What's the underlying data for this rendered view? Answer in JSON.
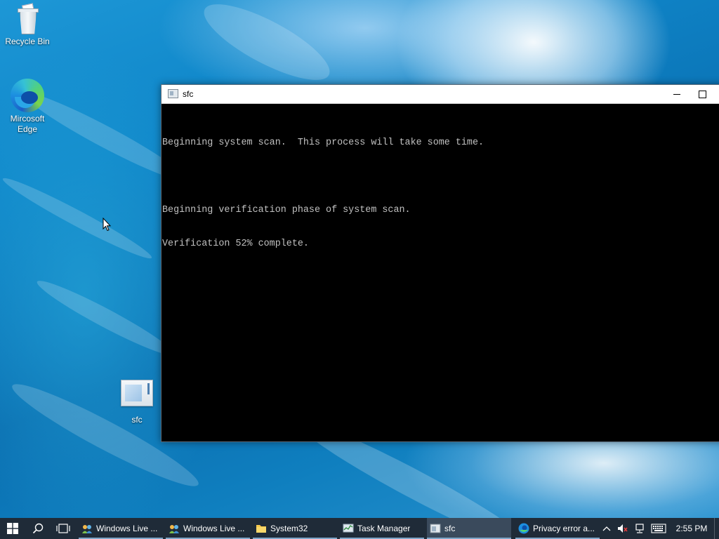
{
  "desktop": {
    "icons": [
      {
        "label": "Recycle Bin",
        "icon": "recycle-bin-icon"
      },
      {
        "label": "Mircosoft\nEdge",
        "icon": "edge-icon"
      },
      {
        "label": "sfc",
        "icon": "sfc-app-icon"
      }
    ]
  },
  "window": {
    "title": "sfc",
    "icon": "console-window-icon",
    "controls": {
      "minimize": "minimize-icon",
      "maximize": "maximize-icon"
    },
    "console_lines": [
      "Beginning system scan.  This process will take some time.",
      "",
      "Beginning verification phase of system scan.",
      "Verification 52% complete."
    ]
  },
  "taskbar": {
    "start": "windows-start-icon",
    "search": "search-icon",
    "taskview": "task-view-icon",
    "apps": [
      {
        "label": "Windows Live ...",
        "icon": "windows-live-icon",
        "active": false
      },
      {
        "label": "Windows Live ...",
        "icon": "windows-live-icon",
        "active": false
      },
      {
        "label": "System32",
        "icon": "folder-icon",
        "active": false
      },
      {
        "label": "Task Manager",
        "icon": "task-manager-icon",
        "active": false
      },
      {
        "label": "sfc",
        "icon": "console-window-icon",
        "active": true
      },
      {
        "label": "Privacy error a...",
        "icon": "edge-icon",
        "active": false
      }
    ],
    "tray": {
      "chevron": "chevron-up-icon",
      "volume": "volume-muted-icon",
      "network": "network-icon",
      "keyboard": "keyboard-icon",
      "time": "2:55 PM"
    }
  },
  "colors": {
    "taskbar": "#1f2b38",
    "console_bg": "#000000",
    "console_text": "#c0c0c0",
    "accent": "#7fa7c9"
  }
}
